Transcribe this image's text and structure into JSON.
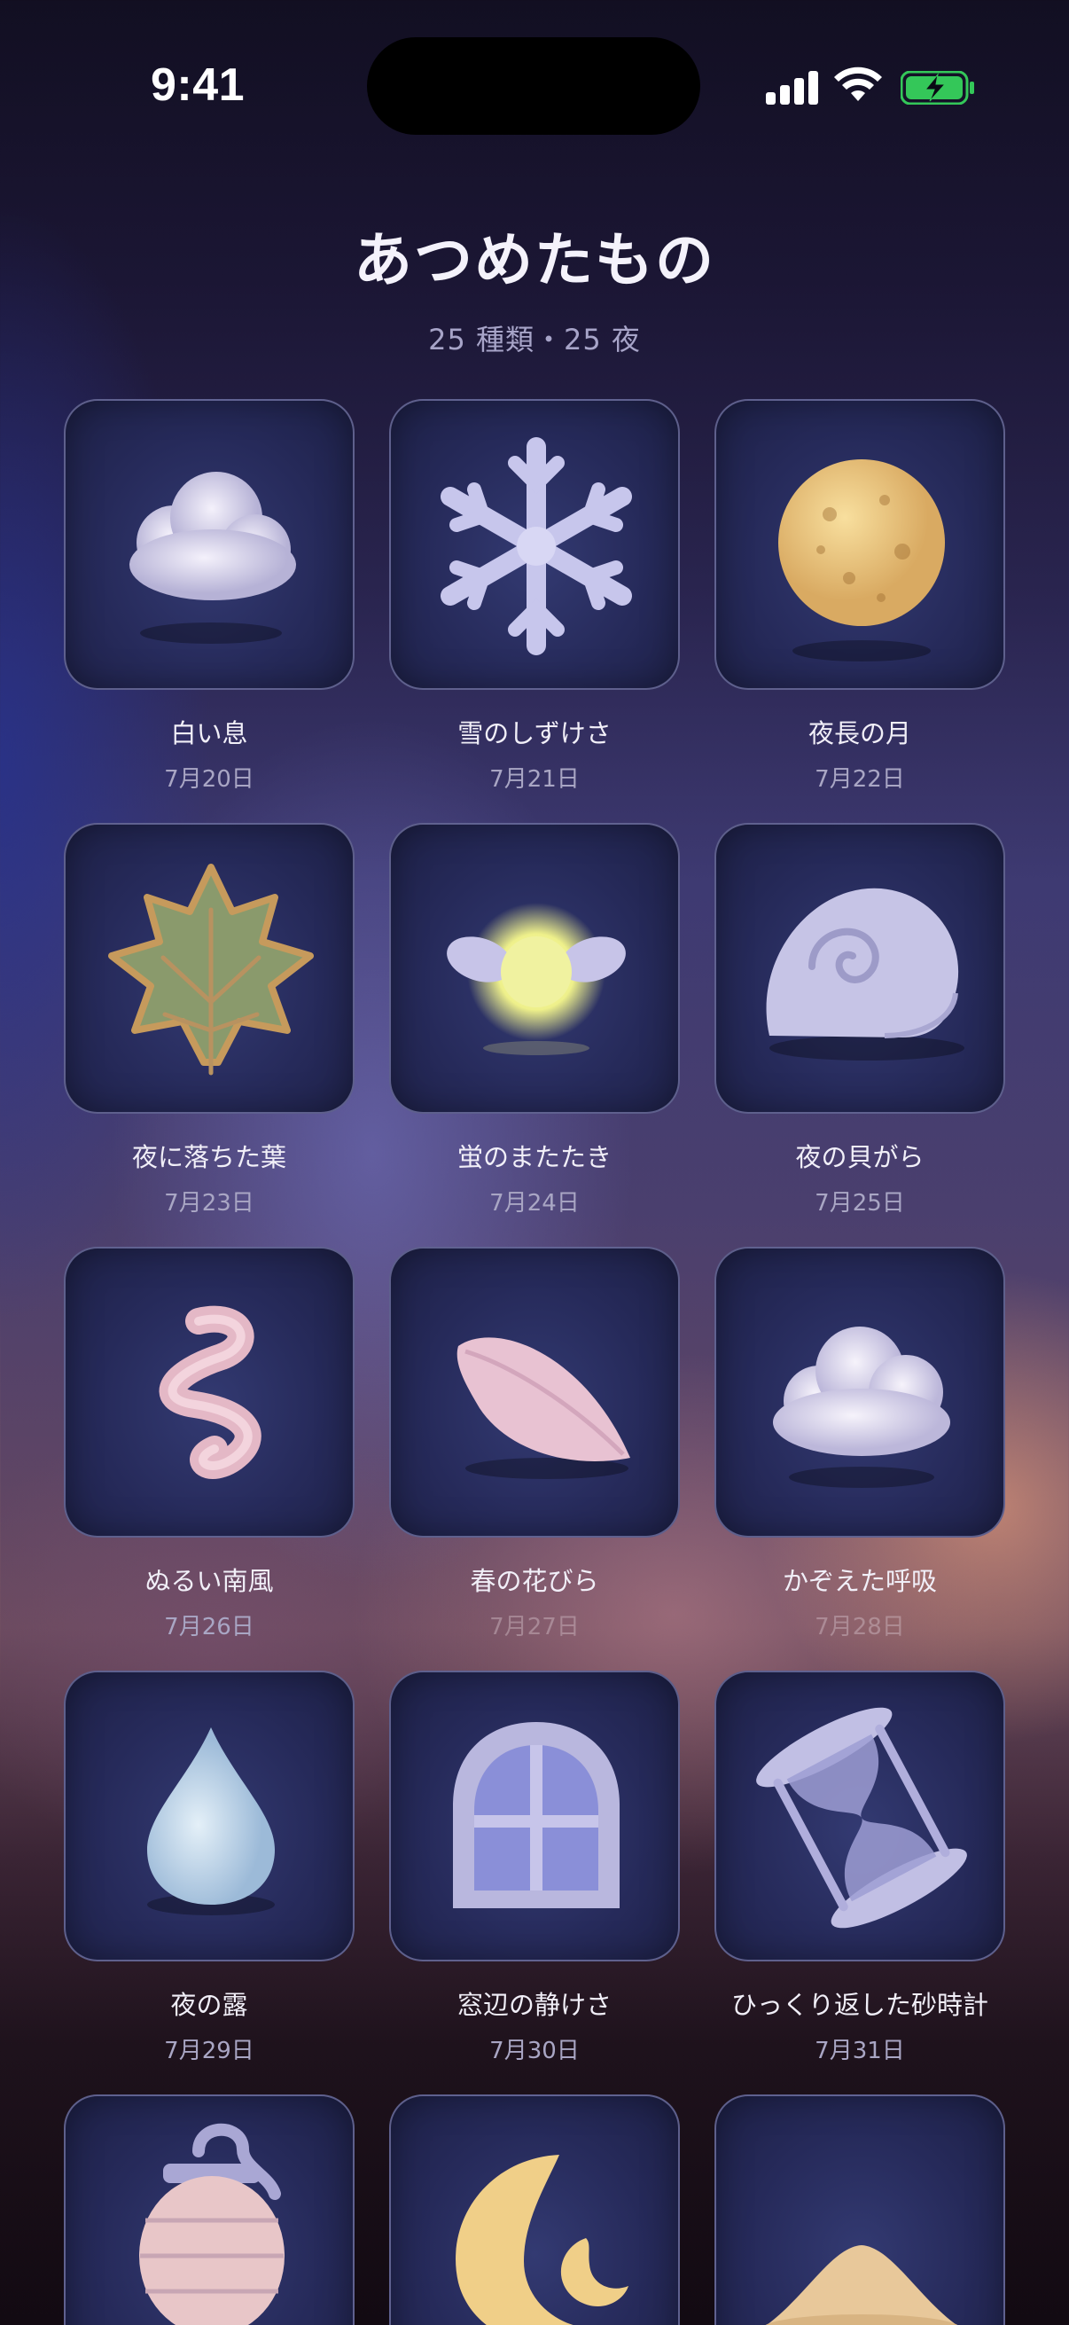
{
  "status_bar": {
    "time": "9:41"
  },
  "header": {
    "title": "あつめたもの",
    "subtitle": "25 種類・25 夜"
  },
  "items": [
    {
      "name": "白い息",
      "date": "7月20日",
      "icon": "cloud-icon"
    },
    {
      "name": "雪のしずけさ",
      "date": "7月21日",
      "icon": "snowflake-icon"
    },
    {
      "name": "夜長の月",
      "date": "7月22日",
      "icon": "full-moon-icon"
    },
    {
      "name": "夜に落ちた葉",
      "date": "7月23日",
      "icon": "leaf-icon"
    },
    {
      "name": "蛍のまたたき",
      "date": "7月24日",
      "icon": "firefly-icon"
    },
    {
      "name": "夜の貝がら",
      "date": "7月25日",
      "icon": "shell-icon"
    },
    {
      "name": "ぬるい南風",
      "date": "7月26日",
      "icon": "wind-ribbon-icon"
    },
    {
      "name": "春の花びら",
      "date": "7月27日",
      "icon": "petal-icon"
    },
    {
      "name": "かぞえた呼吸",
      "date": "7月28日",
      "icon": "cloud-icon"
    },
    {
      "name": "夜の露",
      "date": "7月29日",
      "icon": "dewdrop-icon"
    },
    {
      "name": "窓辺の静けさ",
      "date": "7月30日",
      "icon": "window-icon"
    },
    {
      "name": "ひっくり返した砂時計",
      "date": "7月31日",
      "icon": "hourglass-icon"
    },
    {
      "name": "",
      "date": "",
      "icon": "lantern-icon"
    },
    {
      "name": "",
      "date": "",
      "icon": "crescent-moon-icon"
    },
    {
      "name": "",
      "date": "",
      "icon": "sand-pile-icon"
    }
  ],
  "colors": {
    "tile_background": "#262a5a",
    "title_text": "#f4f2fb",
    "subtitle_text": "#a7a4c8",
    "battery_green": "#34c759"
  }
}
